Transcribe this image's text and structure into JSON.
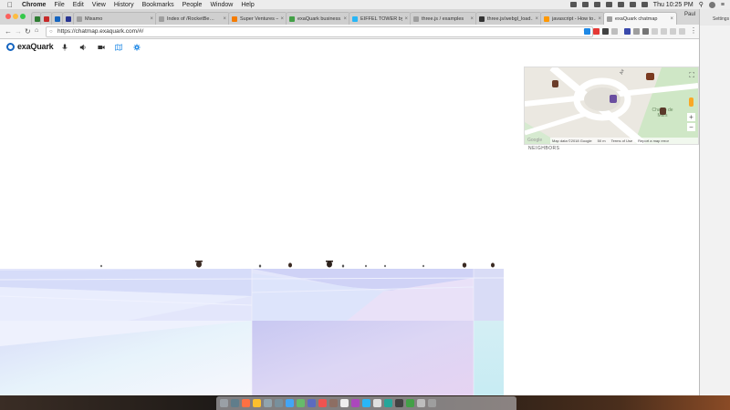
{
  "menubar": {
    "app_name": "Chrome",
    "items": [
      "File",
      "Edit",
      "View",
      "History",
      "Bookmarks",
      "People",
      "Window",
      "Help"
    ],
    "clock": "Thu 10:25 PM"
  },
  "browser": {
    "tabs": [
      {
        "label": "",
        "color": "#2e7d32"
      },
      {
        "label": "",
        "color": "#c62828"
      },
      {
        "label": "",
        "color": "#1565c0"
      },
      {
        "label": "",
        "color": "#283593"
      },
      {
        "label": "Mixamo",
        "color": "#9e9e9e"
      },
      {
        "label": "Index of /RocketBe…",
        "color": "#9e9e9e"
      },
      {
        "label": "Super Ventures – Ex…",
        "color": "#f57c00"
      },
      {
        "label": "exaQuark business…",
        "color": "#43a047"
      },
      {
        "label": "EIFFEL TOWER by…",
        "color": "#29b6f6"
      },
      {
        "label": "three.js / examples",
        "color": "#9e9e9e"
      },
      {
        "label": "three.js/webgl_load…",
        "color": "#333333"
      },
      {
        "label": "javascript - How to…",
        "color": "#ff9800"
      },
      {
        "label": "exaQuark chatmap",
        "color": "#9e9e9e"
      }
    ],
    "profile": "Paul",
    "url": "https://chatmap.exaquark.com/#/"
  },
  "app": {
    "logo_text": "exaQuark",
    "brand_color": "#1565c0",
    "map_attribution": "Map data ©2018 Google",
    "map_scale": "50 m",
    "map_terms": "Terms of Use",
    "map_report": "Report a map error",
    "map_place": "Champ de Mars",
    "map_street": "Av",
    "neighbors_label": "NEIGHBORS"
  },
  "sidebar": {
    "label": "Settings"
  }
}
